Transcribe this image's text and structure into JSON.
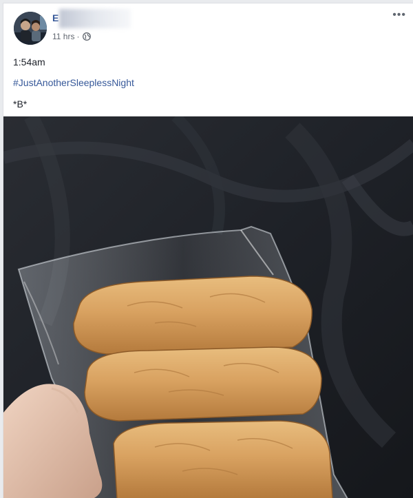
{
  "post": {
    "author_initial": "E",
    "timestamp": "11 hrs",
    "separator": "·",
    "privacy_icon": "globe-icon",
    "more_icon": "more-options-icon",
    "more_glyph": "•••",
    "lines": [
      "1:54am",
      "#JustAnotherSleeplessNight",
      "*B*"
    ]
  },
  "colors": {
    "link": "#365899",
    "text": "#1d2129",
    "meta": "#616770",
    "bun": "#d7a261"
  }
}
